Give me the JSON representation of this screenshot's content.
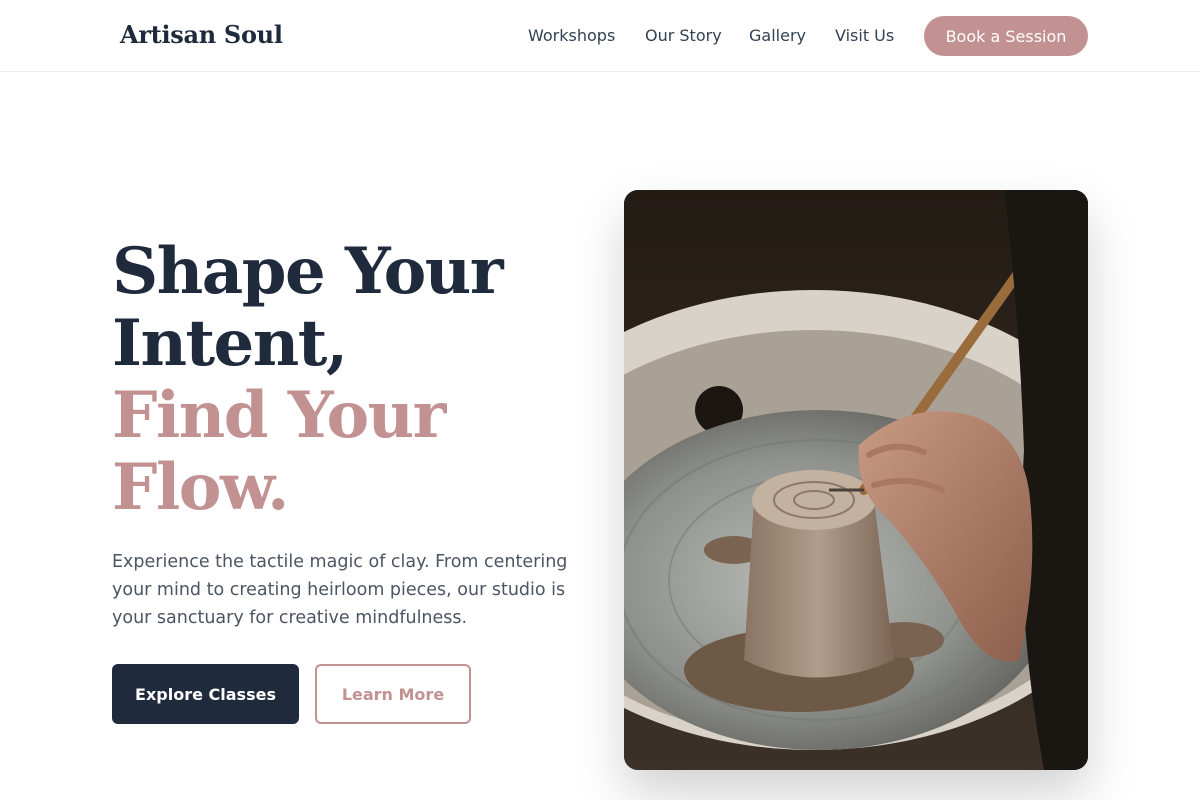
{
  "header": {
    "logo": "Artisan Soul",
    "nav": [
      "Workshops",
      "Our Story",
      "Gallery",
      "Visit Us"
    ],
    "cta": "Book a Session"
  },
  "hero": {
    "headline": [
      "Shape Your",
      "Intent,",
      "Find Your",
      "Flow."
    ],
    "subtext": "Experience the tactile magic of clay. From centering your mind to creating heirloom pieces, our studio is your sanctuary for creative mindfulness.",
    "primary_button": "Explore Classes",
    "secondary_button": "Learn More",
    "image": "pottery-wheel-photo"
  },
  "colors": {
    "accent": "#c29192",
    "navy": "#1f2a3d",
    "text_muted": "#4b5563"
  }
}
